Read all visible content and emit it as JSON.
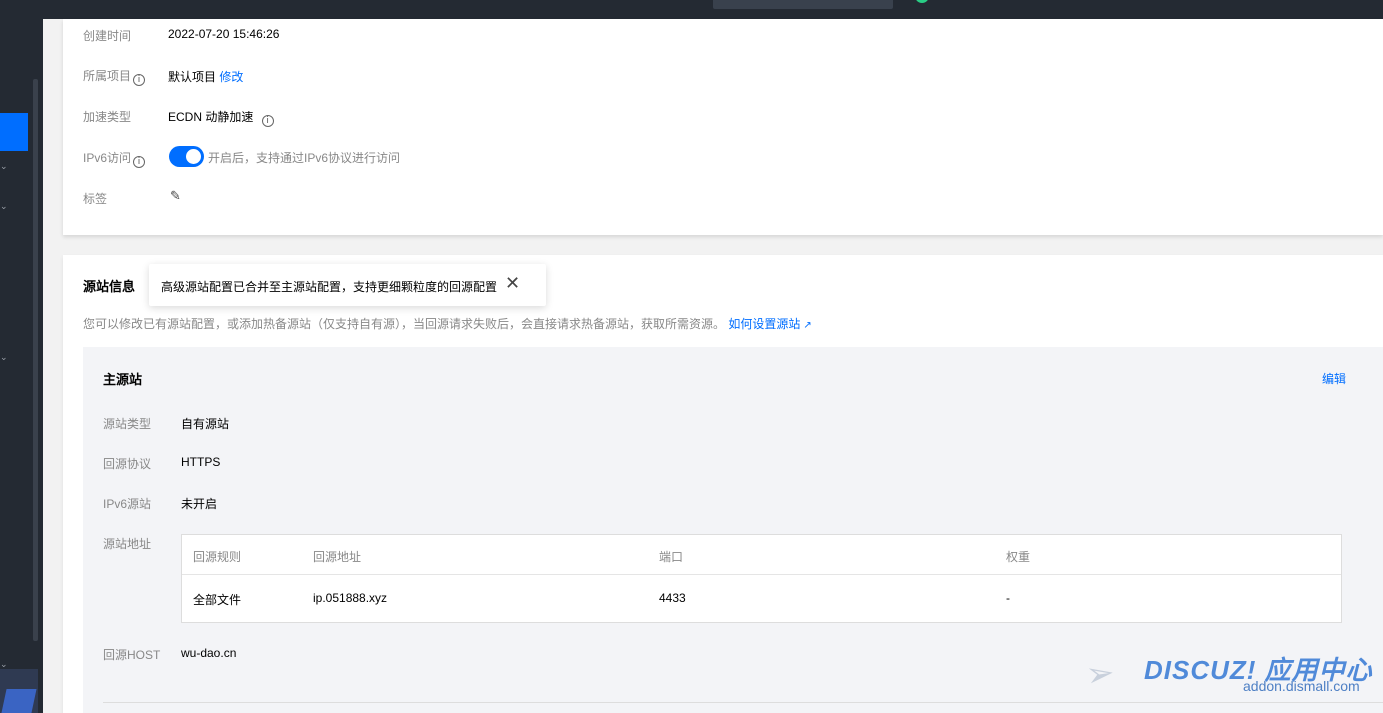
{
  "colors": {
    "accent": "#006eff",
    "sidebar": "#242a33",
    "label": "#888888"
  },
  "basic_info": {
    "create_time": {
      "label": "创建时间",
      "value": "2022-07-20 15:46:26"
    },
    "project": {
      "label": "所属项目",
      "value": "默认项目",
      "action": "修改"
    },
    "accel_type": {
      "label": "加速类型",
      "value": "ECDN 动静加速"
    },
    "ipv6": {
      "label": "IPv6访问",
      "enabled": true,
      "hint": "开启后，支持通过IPv6协议进行访问"
    },
    "tags": {
      "label": "标签",
      "icon": "pencil-icon"
    }
  },
  "origin_info": {
    "title": "源站信息",
    "tooltip": "高级源站配置已合并至主源站配置，支持更细颗粒度的回源配置",
    "description": "您可以修改已有源站配置，或添加热备源站（仅支持自有源），当回源请求失败后，会直接请求热备源站，获取所需资源。",
    "help_link": "如何设置源站",
    "primary": {
      "title": "主源站",
      "edit_label": "编辑",
      "origin_type": {
        "label": "源站类型",
        "value": "自有源站"
      },
      "protocol": {
        "label": "回源协议",
        "value": "HTTPS"
      },
      "ipv6_origin": {
        "label": "IPv6源站",
        "value": "未开启"
      },
      "address": {
        "label": "源站地址",
        "columns": [
          "回源规则",
          "回源地址",
          "端口",
          "权重"
        ],
        "rows": [
          {
            "rule": "全部文件",
            "address": "ip.051888.xyz",
            "port": "4433",
            "weight": "-"
          }
        ]
      },
      "host": {
        "label": "回源HOST",
        "value": "wu-dao.cn"
      }
    }
  },
  "watermark": {
    "brand": "DISCUZ! 应用中心",
    "url": "addon.dismall.com"
  }
}
